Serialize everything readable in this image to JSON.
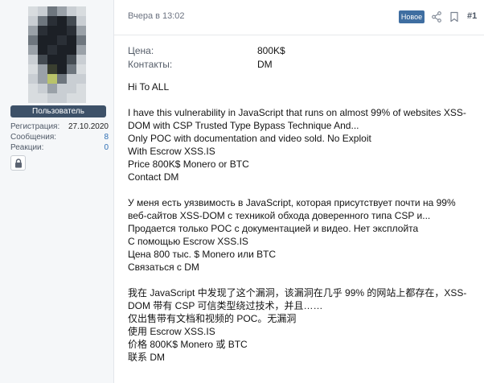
{
  "user": {
    "role": "Пользователь",
    "stats": [
      {
        "label": "Регистрация:",
        "value": "27.10.2020"
      },
      {
        "label": "Сообщения:",
        "value": "8"
      },
      {
        "label": "Реакции:",
        "value": "0"
      }
    ],
    "lock_icon": "lock-icon"
  },
  "post": {
    "timestamp": "Вчера в 13:02",
    "badge": "Новое",
    "share_icon": "share-icon",
    "bookmark_icon": "bookmark-icon",
    "number": "#1",
    "fields": [
      {
        "label": "Цена:",
        "value": "800K$"
      },
      {
        "label": "Контакты:",
        "value": "DM"
      }
    ],
    "greeting": "Hi To ALL",
    "english": [
      "I have this vulnerability in JavaScript that runs on almost 99% of websites XSS-",
      "DOM with CSP Trusted Type Bypass Technique And...",
      "Only POC with documentation and video sold. No Exploit",
      "With Escrow XSS.IS",
      "Price 800K$ Monero or BTC",
      "Contact DM"
    ],
    "russian": [
      "У меня есть уязвимость в JavaScript, которая присутствует почти на 99%",
      "веб-сайтов XSS-DOM с техникой обхода доверенного типа CSP и...",
      "Продается только POC с документацией и видео. Нет эксплойта",
      "С помощью Escrow XSS.IS",
      "Цена 800 тыс. $ Monero или BTC",
      "Связаться с DM"
    ],
    "chinese": [
      "我在 JavaScript 中发现了这个漏洞，该漏洞在几乎 99% 的网站上都存在，XSS-",
      "DOM 带有 CSP 可信类型绕过技术，并且……",
      "仅出售带有文档和视频的 POC。无漏洞",
      "使用 Escrow XSS.IS",
      "价格 800K$ Monero 或 BTC",
      "联系 DM"
    ]
  },
  "colors": {
    "role_badge": "#3d5168",
    "new_badge": "#3f6ea1",
    "link": "#2e6fb4"
  }
}
